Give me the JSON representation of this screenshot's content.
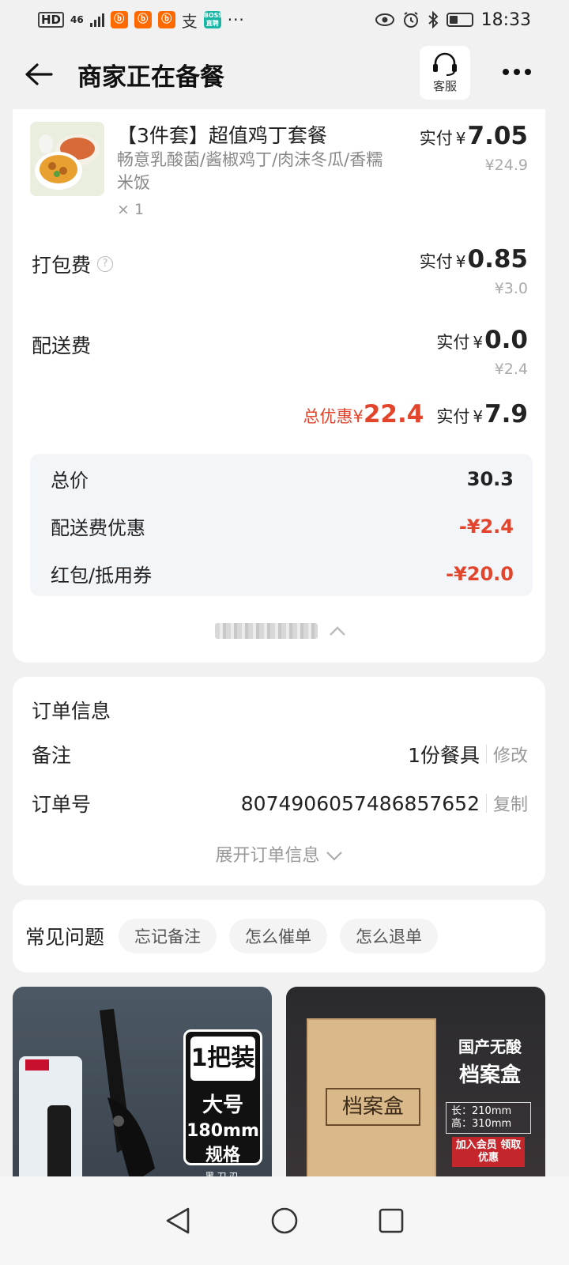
{
  "status_bar": {
    "hd": "HD",
    "network": "46",
    "app_icon_text": "ⓑ",
    "alipay": "支",
    "boss_label": "BOSS直聘",
    "more": "···",
    "time": "18:33"
  },
  "header": {
    "title": "商家正在备餐",
    "service_label": "客服"
  },
  "order_item": {
    "title": "【3件套】超值鸡丁套餐",
    "description": "畅意乳酸菌/酱椒鸡丁/肉沫冬瓜/香糯米饭",
    "quantity": "× 1",
    "pay_label": "实付",
    "yen": "¥",
    "pay_value": "7.05",
    "original": "¥24.9"
  },
  "packing_fee": {
    "label": "打包费",
    "help_icon": "?",
    "pay_label": "实付",
    "yen": "¥",
    "pay_value": "0.85",
    "original": "¥3.0"
  },
  "delivery_fee": {
    "label": "配送费",
    "pay_label": "实付",
    "yen": "¥",
    "pay_value": "0.0",
    "original": "¥2.4"
  },
  "total": {
    "discount_label": "总优惠",
    "yen": "¥",
    "discount_value": "22.4",
    "pay_label": "实付",
    "pay_value": "7.9"
  },
  "summary": {
    "rows": [
      {
        "label": "总价",
        "value": "30.3"
      },
      {
        "label": "配送费优惠",
        "value": "-¥2.4"
      },
      {
        "label": "红包/抵用券",
        "value": "-¥20.0"
      }
    ]
  },
  "order_info": {
    "title": "订单信息",
    "note_label": "备注",
    "note_value": "1份餐具",
    "note_action": "修改",
    "order_no_label": "订单号",
    "order_no_value": "8074906057486857652",
    "order_no_action": "复制",
    "expand_label": "展开订单信息"
  },
  "faq": {
    "title": "常见问题",
    "chips": [
      "忘记备注",
      "怎么催单",
      "怎么退单"
    ]
  },
  "ads": {
    "ad1": {
      "b1": "1把装",
      "b2": "大号",
      "b3": "180mm规格",
      "b4": "黑刀刃"
    },
    "ad2": {
      "box_title": "档案盒",
      "h1": "国产无酸",
      "h2": "档案盒",
      "dim": "长：210mm 高：310mm",
      "promo": "加入会员 领取优惠"
    }
  },
  "colors": {
    "accent_red": "#e2452b",
    "summary_bg": "#f3f6f9",
    "page_bg": "#f1f1f1"
  }
}
